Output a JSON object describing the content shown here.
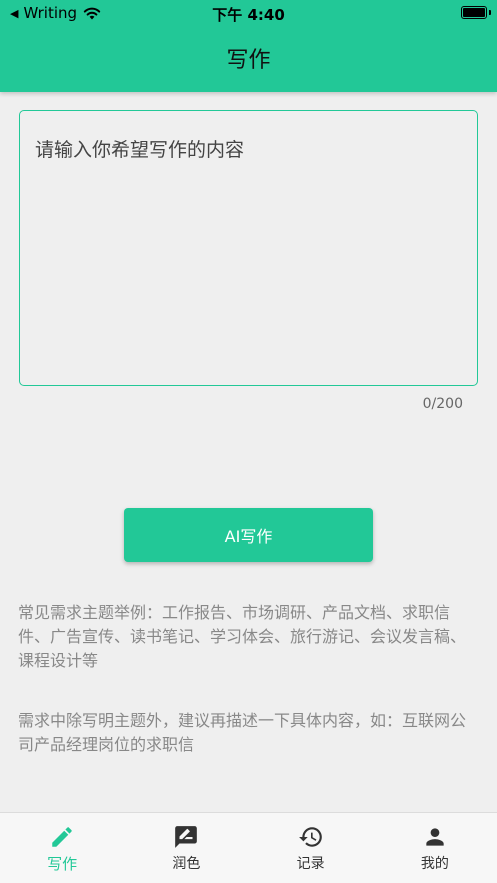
{
  "status_bar": {
    "back_app": "Writing",
    "time": "下午 4:40"
  },
  "header": {
    "title": "写作"
  },
  "editor": {
    "placeholder": "请输入你希望写作的内容",
    "counter": "0/200"
  },
  "action": {
    "button_label": "AI写作"
  },
  "hints": {
    "examples": "常见需求主题举例：工作报告、市场调研、产品文档、求职信件、广告宣传、读书笔记、学习体会、旅行游记、会议发言稿、课程设计等",
    "suggestion": "需求中除写明主题外，建议再描述一下具体内容，如：互联网公司产品经理岗位的求职信"
  },
  "tabbar": {
    "active_color": "#22c897",
    "inactive_color": "#333333",
    "items": [
      {
        "label": "写作",
        "icon": "pencil-icon",
        "active": true
      },
      {
        "label": "润色",
        "icon": "edit-note-icon",
        "active": false
      },
      {
        "label": "记录",
        "icon": "history-icon",
        "active": false
      },
      {
        "label": "我的",
        "icon": "person-icon",
        "active": false
      }
    ]
  },
  "colors": {
    "accent": "#22c897",
    "background": "#efefef"
  }
}
